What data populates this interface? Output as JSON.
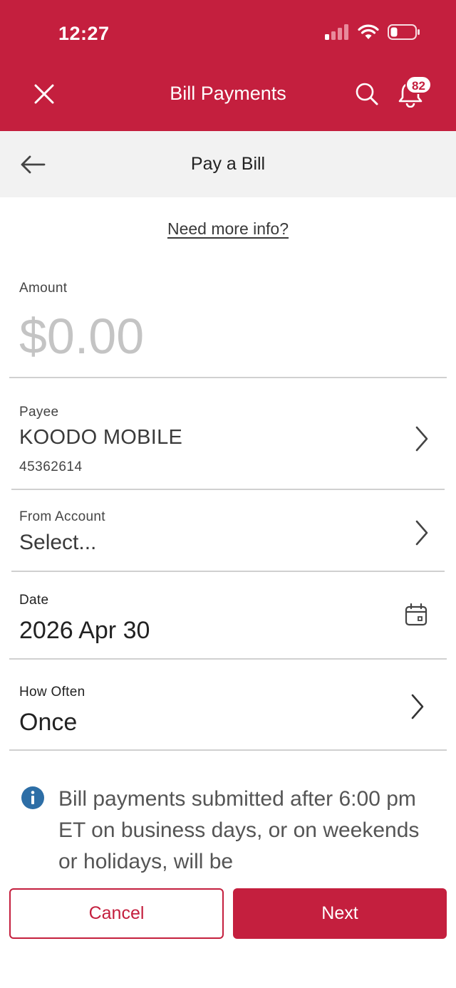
{
  "status_bar": {
    "time": "12:27"
  },
  "header": {
    "title": "Bill Payments",
    "notification_count": "82"
  },
  "subheader": {
    "title": "Pay a Bill"
  },
  "info_link": "Need more info?",
  "amount": {
    "label": "Amount",
    "value": "$0.00"
  },
  "payee": {
    "label": "Payee",
    "name": "KOODO MOBILE",
    "number": "45362614"
  },
  "from_account": {
    "label": "From Account",
    "value": "Select..."
  },
  "date": {
    "label": "Date",
    "value": "2026 Apr 30"
  },
  "how_often": {
    "label": "How Often",
    "value": "Once"
  },
  "notice": {
    "text": "Bill payments submitted after 6:00 pm ET on business days, or on weekends or holidays, will be"
  },
  "buttons": {
    "cancel": "Cancel",
    "next": "Next"
  },
  "colors": {
    "brand": "#c41f3e",
    "subheader_bg": "#f2f2f2",
    "info_blue": "#2d6ea6",
    "placeholder": "#c4c4c4"
  },
  "icons": [
    "cellular-signal-icon",
    "wifi-icon",
    "battery-icon",
    "close-icon",
    "search-icon",
    "bell-icon",
    "back-arrow-icon",
    "chevron-right-icon",
    "calendar-icon",
    "info-icon"
  ]
}
